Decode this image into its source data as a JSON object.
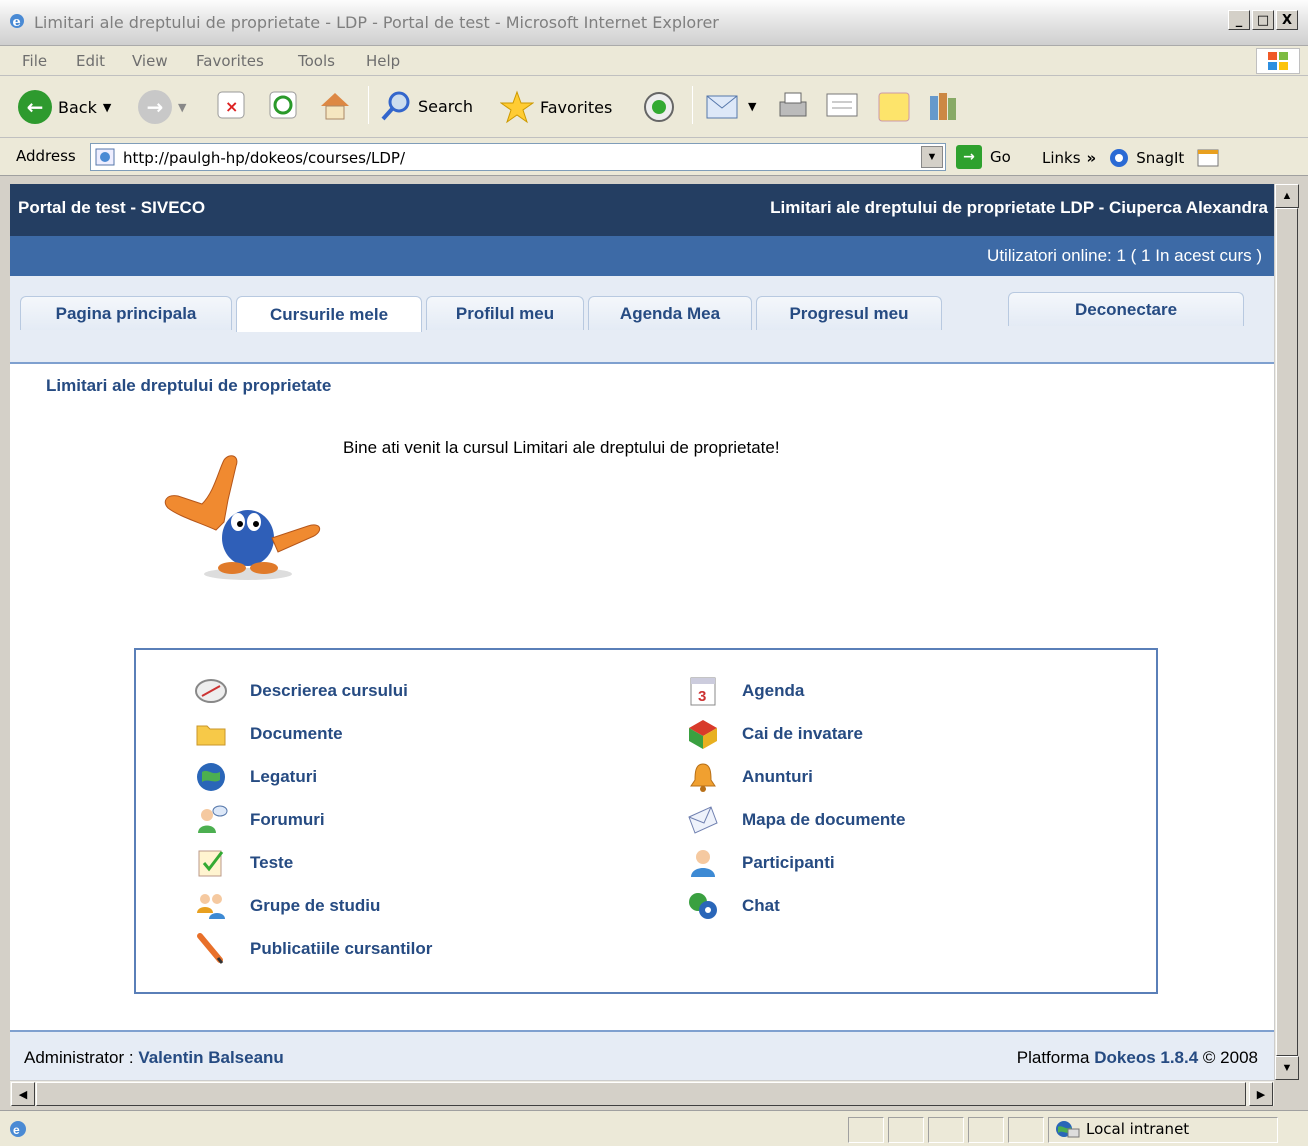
{
  "window": {
    "title": "Limitari ale dreptului de proprietate - LDP - Portal de test - Microsoft Internet Explorer",
    "min": "_",
    "max": "□",
    "close": "X"
  },
  "menu": [
    "File",
    "Edit",
    "View",
    "Favorites",
    "Tools",
    "Help"
  ],
  "toolbar": {
    "back": "Back",
    "search": "Search",
    "favorites": "Favorites"
  },
  "address": {
    "label": "Address",
    "url": "http://paulgh-hp/dokeos/courses/LDP/",
    "go": "Go",
    "links": "Links",
    "chevrons": "»",
    "snagit": "SnagIt"
  },
  "site": {
    "portal": "Portal de test - SIVECO",
    "course_header": "Limitari ale dreptului de proprietate LDP - Ciuperca Alexandra",
    "online": "Utilizatori online:  1  ( 1 In acest curs  )"
  },
  "tabs": [
    "Pagina principala",
    "Cursurile mele",
    "Profilul meu",
    "Agenda Mea",
    "Progresul meu"
  ],
  "logout": "Deconectare",
  "course_title": "Limitari ale dreptului de proprietate",
  "welcome": "Bine ati venit la cursul Limitari ale dreptului de proprietate!",
  "tools_left": [
    {
      "label": "Descrierea cursului",
      "icon": "description-icon"
    },
    {
      "label": "Documente",
      "icon": "folder-icon"
    },
    {
      "label": "Legaturi",
      "icon": "globe-icon"
    },
    {
      "label": "Forumuri",
      "icon": "forum-icon"
    },
    {
      "label": "Teste",
      "icon": "quiz-icon"
    },
    {
      "label": "Grupe de studiu",
      "icon": "group-icon"
    },
    {
      "label": "Publicatiile cursantilor",
      "icon": "pen-icon"
    }
  ],
  "tools_right": [
    {
      "label": "Agenda",
      "icon": "calendar-icon"
    },
    {
      "label": "Cai de invatare",
      "icon": "learning-path-icon"
    },
    {
      "label": "Anunturi",
      "icon": "bell-icon"
    },
    {
      "label": "Mapa de documente",
      "icon": "envelope-icon"
    },
    {
      "label": "Participanti",
      "icon": "user-icon"
    },
    {
      "label": "Chat",
      "icon": "chat-icon"
    }
  ],
  "footer": {
    "admin_label": "Administrator : ",
    "admin_name": "Valentin Balseanu",
    "platform_label": "Platforma ",
    "platform_name": "Dokeos 1.8.4",
    "copyright": " © 2008"
  },
  "status": {
    "zone": "Local intranet"
  }
}
